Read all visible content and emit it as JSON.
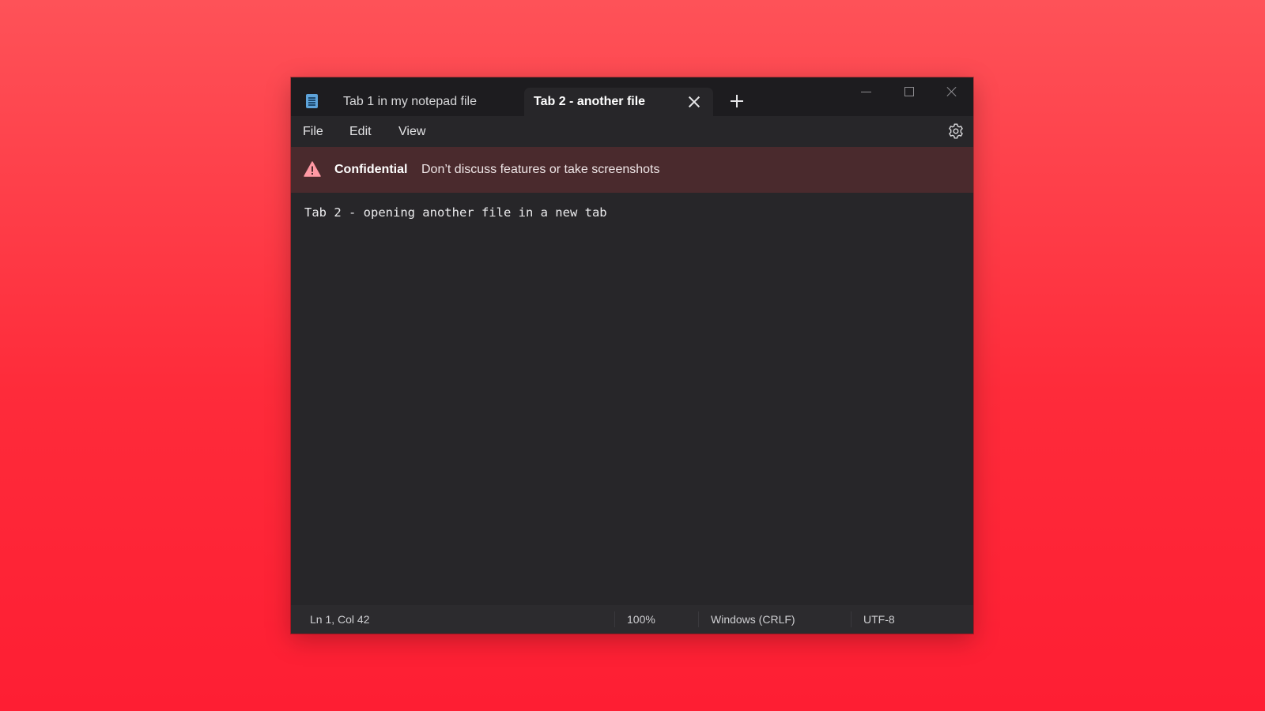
{
  "window": {
    "tabs": [
      {
        "label": "Tab 1 in my notepad file",
        "active": false
      },
      {
        "label": "Tab 2 - another file",
        "active": true
      }
    ]
  },
  "menu": {
    "file": "File",
    "edit": "Edit",
    "view": "View"
  },
  "banner": {
    "title": "Confidential",
    "message": "Don’t discuss features or take screenshots"
  },
  "editor": {
    "content": "Tab 2 - opening another file in a new tab"
  },
  "status": {
    "position": "Ln 1, Col 42",
    "zoom": "100%",
    "line_ending": "Windows (CRLF)",
    "encoding": "UTF-8"
  },
  "icons": {
    "app": "notepad-icon",
    "tab_close": "close-icon",
    "new_tab": "plus-icon",
    "settings": "gear-icon",
    "warning": "warning-icon"
  },
  "colors": {
    "background": "#fe3040",
    "window": "#272629",
    "titlebar": "#1d1c1f",
    "banner": "#4a2a2d",
    "warning_icon": "#ff99a4"
  }
}
